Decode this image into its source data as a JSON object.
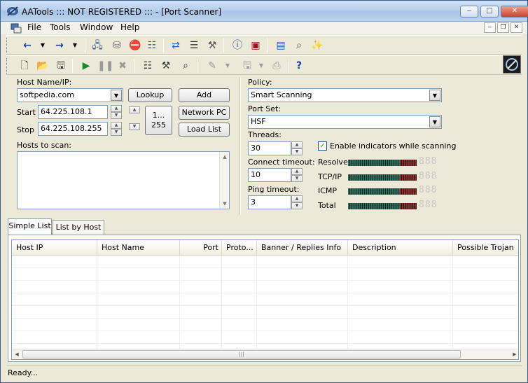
{
  "window": {
    "title": "AATools ::: NOT REGISTERED ::: - [Port Scanner]",
    "minimize": "‒",
    "maximize": "□",
    "close": "✕"
  },
  "menu": {
    "items": [
      "File",
      "Tools",
      "Window",
      "Help"
    ]
  },
  "mdi": {
    "minimize": "‒",
    "restore": "❐",
    "close": "✕"
  },
  "form": {
    "host_label": "Host Name/IP:",
    "host_value": "softpedia.com",
    "lookup_label": "Lookup",
    "add_label": "Add",
    "network_pc_label": "Network PC",
    "load_list_label": "Load List",
    "start_label": "Start",
    "start_value": "64.225.108.1",
    "stop_label": "Stop",
    "stop_value": "64.225.108.255",
    "range_button_line1": "1...",
    "range_button_line2": "255",
    "hosts_to_scan_label": "Hosts to scan:"
  },
  "settings": {
    "policy_label": "Policy:",
    "policy_value": "Smart Scanning",
    "port_set_label": "Port Set:",
    "port_set_value": "HSF",
    "threads_label": "Threads:",
    "threads_value": "30",
    "connect_timeout_label": "Connect timeout:",
    "connect_timeout_value": "10",
    "ping_timeout_label": "Ping timeout:",
    "ping_timeout_value": "3",
    "indicators_label": "Enable indicators while scanning",
    "indicators_checked": true
  },
  "indicators": [
    {
      "label": "Resolve",
      "digits": "888"
    },
    {
      "label": "TCP/IP",
      "digits": "888"
    },
    {
      "label": "ICMP",
      "digits": "888"
    },
    {
      "label": "Total",
      "digits": "888"
    }
  ],
  "tabs": [
    {
      "label": "Simple List",
      "active": true
    },
    {
      "label": "List by Host",
      "active": false
    }
  ],
  "table": {
    "columns": [
      "Host IP",
      "Host Name",
      "Port",
      "Proto...",
      "Banner / Replies Info",
      "Description",
      "Possible Trojan"
    ],
    "rows": []
  },
  "status": {
    "text": "Ready..."
  },
  "toolbar1": {
    "icons": [
      "back-arrow-icon",
      "back-dropdown-icon",
      "forward-arrow-icon",
      "forward-dropdown-icon",
      "network-computer-icon",
      "database-icon",
      "block-icon",
      "servers-icon",
      "network-transfer-icon",
      "document-list-icon",
      "computer-tools-icon",
      "info-icon",
      "window-icon",
      "monitor-icon",
      "search-window-icon",
      "wizard-icon"
    ]
  },
  "toolbar2": {
    "icons": [
      "new-document-icon",
      "open-icon",
      "save-list-icon",
      "play-icon",
      "pause-icon",
      "stop-icon",
      "network-icon",
      "tools-icon",
      "magnify-icon",
      "brush-icon",
      "disk-icon",
      "print-icon",
      "help-icon"
    ]
  }
}
